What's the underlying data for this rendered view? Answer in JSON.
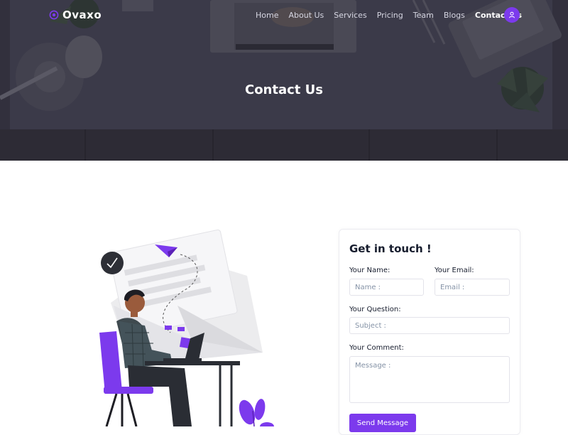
{
  "brand": {
    "name": "Ovaxo",
    "logo_icon": "target-ring-icon"
  },
  "nav": {
    "items": [
      {
        "label": "Home",
        "active": false
      },
      {
        "label": "About Us",
        "active": false
      },
      {
        "label": "Services",
        "active": false
      },
      {
        "label": "Pricing",
        "active": false
      },
      {
        "label": "Team",
        "active": false
      },
      {
        "label": "Blogs",
        "active": false
      },
      {
        "label": "Contact us",
        "active": true
      }
    ],
    "user_icon": "user-icon"
  },
  "hero": {
    "title": "Contact Us"
  },
  "form": {
    "title": "Get in touch !",
    "name_label": "Your Name:",
    "name_placeholder": "Name :",
    "email_label": "Your Email:",
    "email_placeholder": "Email :",
    "question_label": "Your Question:",
    "question_placeholder": "Subject :",
    "comment_label": "Your Comment:",
    "comment_placeholder": "Message :",
    "submit_label": "Send Message"
  },
  "colors": {
    "accent": "#7c3aed",
    "hero_overlay": "#3a3a4c",
    "heading": "#161c2d"
  }
}
